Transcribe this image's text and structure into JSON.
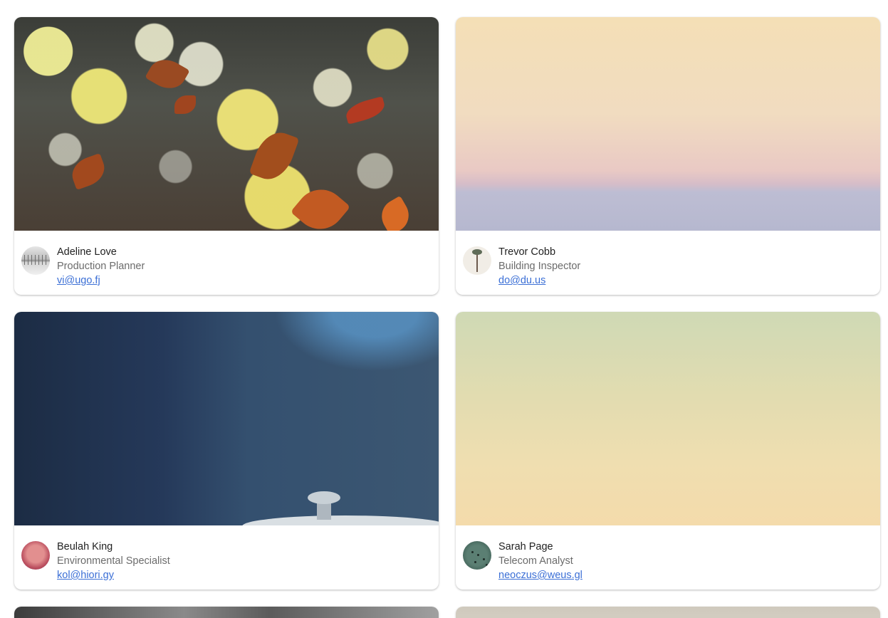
{
  "cards": [
    {
      "name": "Adeline Love",
      "role": "Production Planner",
      "email": "vi@ugo.fj",
      "cover_image": "bokeh-autumn-leaves",
      "avatar_image": "bridge-monochrome"
    },
    {
      "name": "Trevor Cobb",
      "role": "Building Inspector",
      "email": "do@du.us",
      "cover_image": "pastel-sky-horizon",
      "avatar_image": "palm-trees"
    },
    {
      "name": "Beulah King",
      "role": "Environmental Specialist",
      "email": "kol@hiori.gy",
      "cover_image": "blue-knob-closeup",
      "avatar_image": "pink-abstract"
    },
    {
      "name": "Sarah Page",
      "role": "Telecom Analyst",
      "email": "neoczus@weus.gl",
      "cover_image": "pale-yellow-sky",
      "avatar_image": "green-birds"
    }
  ],
  "colors": {
    "link": "#3b6fd6",
    "name_text": "#222222",
    "role_text": "#6b6b6b",
    "card_bg": "#ffffff"
  }
}
